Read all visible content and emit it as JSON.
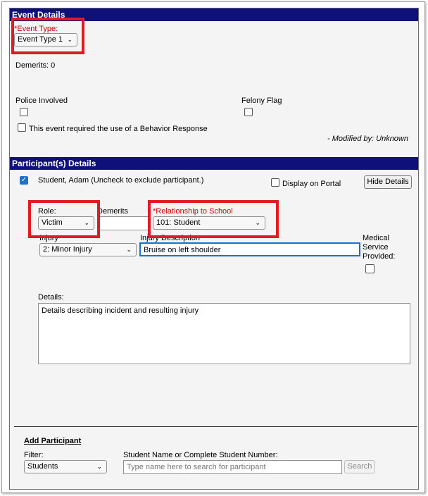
{
  "event_details": {
    "header": "Event Details",
    "event_type_label": "*Event Type:",
    "event_type_value": "Event Type 1",
    "demerits": "Demerits: 0",
    "police_involved_label": "Police Involved",
    "felony_flag_label": "Felony Flag",
    "behavior_response_label": "This event required the use of a Behavior Response",
    "modified_by": "- Modified by: Unknown"
  },
  "participants": {
    "header": "Participant(s) Details",
    "participant_label": "Student, Adam (Uncheck to exclude participant.)",
    "display_on_portal_label": "Display on Portal",
    "hide_details_button": "Hide Details",
    "role_label": "Role:",
    "role_value": "Victim",
    "demerits_label": "Demerits",
    "relationship_label": "*Relationship to School",
    "relationship_value": "101: Student",
    "injury_label": "Injury",
    "injury_value": "2: Minor Injury",
    "injury_description_label": "Injury Description",
    "injury_description_value": "Bruise on left shoulder",
    "medical_label_1": "Medical",
    "medical_label_2": "Service",
    "medical_label_3": "Provided:",
    "details_label": "Details:",
    "details_value": "Details describing incident and resulting injury"
  },
  "add_participant": {
    "title": "Add Participant",
    "filter_label": "Filter:",
    "filter_value": "Students",
    "search_label": "Student Name or Complete Student Number:",
    "search_placeholder": "Type name here to search for participant",
    "search_button": "Search"
  },
  "colors": {
    "header_bg": "#10107a",
    "highlight": "#e01b24",
    "required_label": "#d00000",
    "checkbox_checked": "#1f6fd1"
  }
}
